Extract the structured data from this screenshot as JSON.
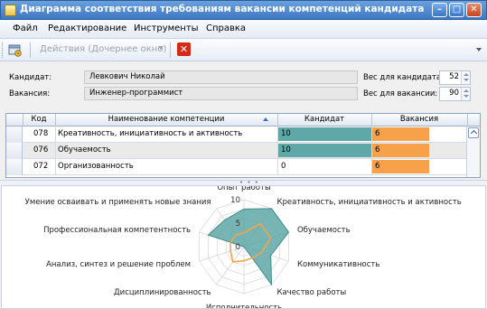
{
  "window": {
    "title": "Диаграмма соответствия требованиям вакансии компетенций кандидата",
    "controls": {
      "minimize": "–",
      "maximize": "□",
      "close": "✕"
    }
  },
  "menu": {
    "items": [
      "Файл",
      "Редактирование",
      "Инструменты",
      "Справка"
    ]
  },
  "toolbar": {
    "actions_label": "Действия (Дочернее окно)",
    "icons": [
      "settings-icon",
      "delete-icon"
    ]
  },
  "info": {
    "candidate_label": "Кандидат:",
    "candidate_value": "Левкович Николай",
    "vacancy_label": "Вакансия:",
    "vacancy_value": "Инженер-программист",
    "candidate_weight_label": "Вес для кандидата:",
    "candidate_weight_value": "52",
    "vacancy_weight_label": "Вес для вакансии:",
    "vacancy_weight_value": "90"
  },
  "grid": {
    "columns": [
      "Код",
      "Наименование компетенции",
      "Кандидат",
      "Вакансия"
    ],
    "rows": [
      {
        "code": "078",
        "name": "Креативность, инициативность и активность",
        "candidate": 10,
        "vacancy": 6,
        "candidate_text": "10",
        "vacancy_text": "6"
      },
      {
        "code": "076",
        "name": "Обучаемость",
        "candidate": 10,
        "vacancy": 6,
        "candidate_text": "10",
        "vacancy_text": "6"
      },
      {
        "code": "072",
        "name": "Организованность",
        "candidate": 0,
        "vacancy": 6,
        "candidate_text": "0",
        "vacancy_text": "6"
      }
    ],
    "colors": {
      "candidate_bar": "#5fa8a8",
      "vacancy_bar": "#f7a24a"
    }
  },
  "chart_data": {
    "type": "radar",
    "axis_ticks": [
      "10",
      "5",
      "0"
    ],
    "range": [
      0,
      10
    ],
    "categories": [
      "Опыт работы",
      "Креативность, инициативность и активность",
      "Обучаемость",
      "Коммуникативность",
      "Качество работы",
      "Исполнительность",
      "Дисциплинированность",
      "Анализ, синтез и решение проблем",
      "Профессиональная компетентность",
      "Умение осваивать и применять новые знания"
    ],
    "series": [
      {
        "values": [
          8,
          10,
          10,
          6,
          10,
          0,
          0,
          0,
          8,
          7
        ],
        "color": "#5fa8a8",
        "fill": true
      },
      {
        "values": [
          3,
          6,
          6,
          4,
          3,
          3,
          4,
          3,
          3,
          3
        ],
        "color": "#f7a24a",
        "fill": false
      }
    ],
    "note": "series values are estimated from the radar plot"
  }
}
